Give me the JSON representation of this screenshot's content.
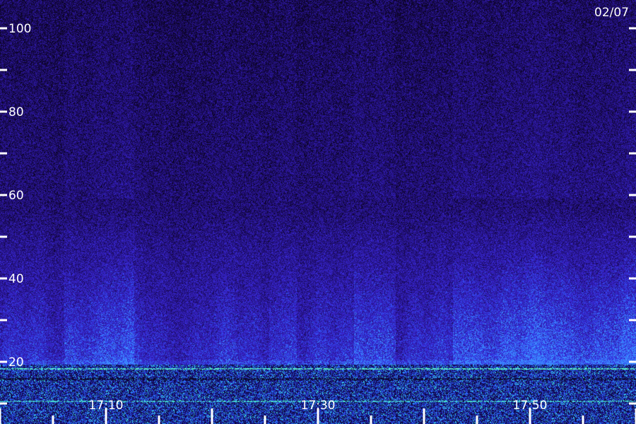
{
  "chart_data": {
    "type": "heatmap",
    "date_label": "02/07",
    "y_axis": {
      "ticks": [
        20,
        40,
        60,
        80,
        100
      ],
      "tick_labels": [
        "20",
        "40",
        "60",
        "80",
        "100"
      ],
      "minor_ticks": [
        10,
        30,
        50,
        70,
        90,
        110
      ],
      "range": [
        0,
        111
      ]
    },
    "x_axis": {
      "tick_labels": [
        "17:10",
        "17:30",
        "17:50"
      ],
      "major_ticks": [
        "17:00",
        "17:10",
        "17:20",
        "17:30",
        "17:40",
        "17:50",
        "18:00"
      ],
      "minor_tick_step_minutes": 5,
      "range": [
        "17:00",
        "18:00"
      ]
    },
    "colors": {
      "background": "#1a0a5a",
      "low": "#14063a",
      "mid": "#3a2ab0",
      "high": "#4aa8ff",
      "peak": "#66ffcc",
      "axis": "#ffffff"
    }
  }
}
